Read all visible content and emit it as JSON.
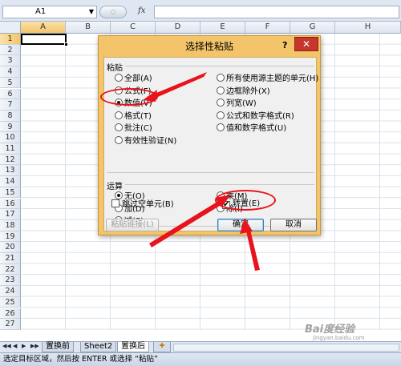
{
  "formula_bar": {
    "name_box": "A1",
    "fx_label": "fx",
    "formula": ""
  },
  "columns": [
    "A",
    "B",
    "C",
    "D",
    "E",
    "F",
    "G",
    "H"
  ],
  "rows": [
    "1",
    "2",
    "3",
    "4",
    "5",
    "6",
    "7",
    "8",
    "9",
    "10",
    "11",
    "12",
    "13",
    "14",
    "15",
    "16",
    "17",
    "18",
    "19",
    "20",
    "21",
    "22",
    "23",
    "24",
    "25",
    "26",
    "27"
  ],
  "selected": {
    "column": "A",
    "row": "1"
  },
  "dialog": {
    "title": "选择性粘贴",
    "help": "?",
    "close": "✕",
    "paste_group": "粘贴",
    "paste_left": [
      {
        "label": "全部(A)",
        "selected": false
      },
      {
        "label": "公式(F)",
        "selected": false
      },
      {
        "label": "数值(V)",
        "selected": true
      },
      {
        "label": "格式(T)",
        "selected": false
      },
      {
        "label": "批注(C)",
        "selected": false
      },
      {
        "label": "有效性验证(N)",
        "selected": false
      }
    ],
    "paste_right": [
      {
        "label": "所有使用源主题的单元(H)",
        "selected": false
      },
      {
        "label": "边框除外(X)",
        "selected": false
      },
      {
        "label": "列宽(W)",
        "selected": false
      },
      {
        "label": "公式和数字格式(R)",
        "selected": false
      },
      {
        "label": "值和数字格式(U)",
        "selected": false
      }
    ],
    "op_group": "运算",
    "op_left": [
      {
        "label": "无(O)",
        "selected": true
      },
      {
        "label": "加(D)",
        "selected": false
      },
      {
        "label": "减(S)",
        "selected": false
      }
    ],
    "op_right": [
      {
        "label": "乘(M)",
        "selected": false
      },
      {
        "label": "除(I)",
        "selected": false
      }
    ],
    "skip_blanks": {
      "label": "跳过空单元(B)",
      "checked": false
    },
    "transpose": {
      "label": "转置(E)",
      "checked": true,
      "mark": "✔"
    },
    "paste_link": "粘贴链接(L)",
    "ok": "确定",
    "cancel": "取消"
  },
  "sheet_nav": [
    "◀◀",
    "◀",
    "▶",
    "▶▶"
  ],
  "sheets": [
    {
      "label": "置换前",
      "active": false
    },
    {
      "label": "Sheet2",
      "active": false
    },
    {
      "label": "置换后",
      "active": true
    }
  ],
  "status": "选定目标区域，然后按 ENTER 或选择 “粘贴”",
  "watermark": {
    "brand": "Bai度经验",
    "url": "jingyan.baidu.com"
  },
  "colors": {
    "accent": "#e8131c",
    "dialog_frame": "#f3c46a",
    "close": "#c7362b"
  }
}
